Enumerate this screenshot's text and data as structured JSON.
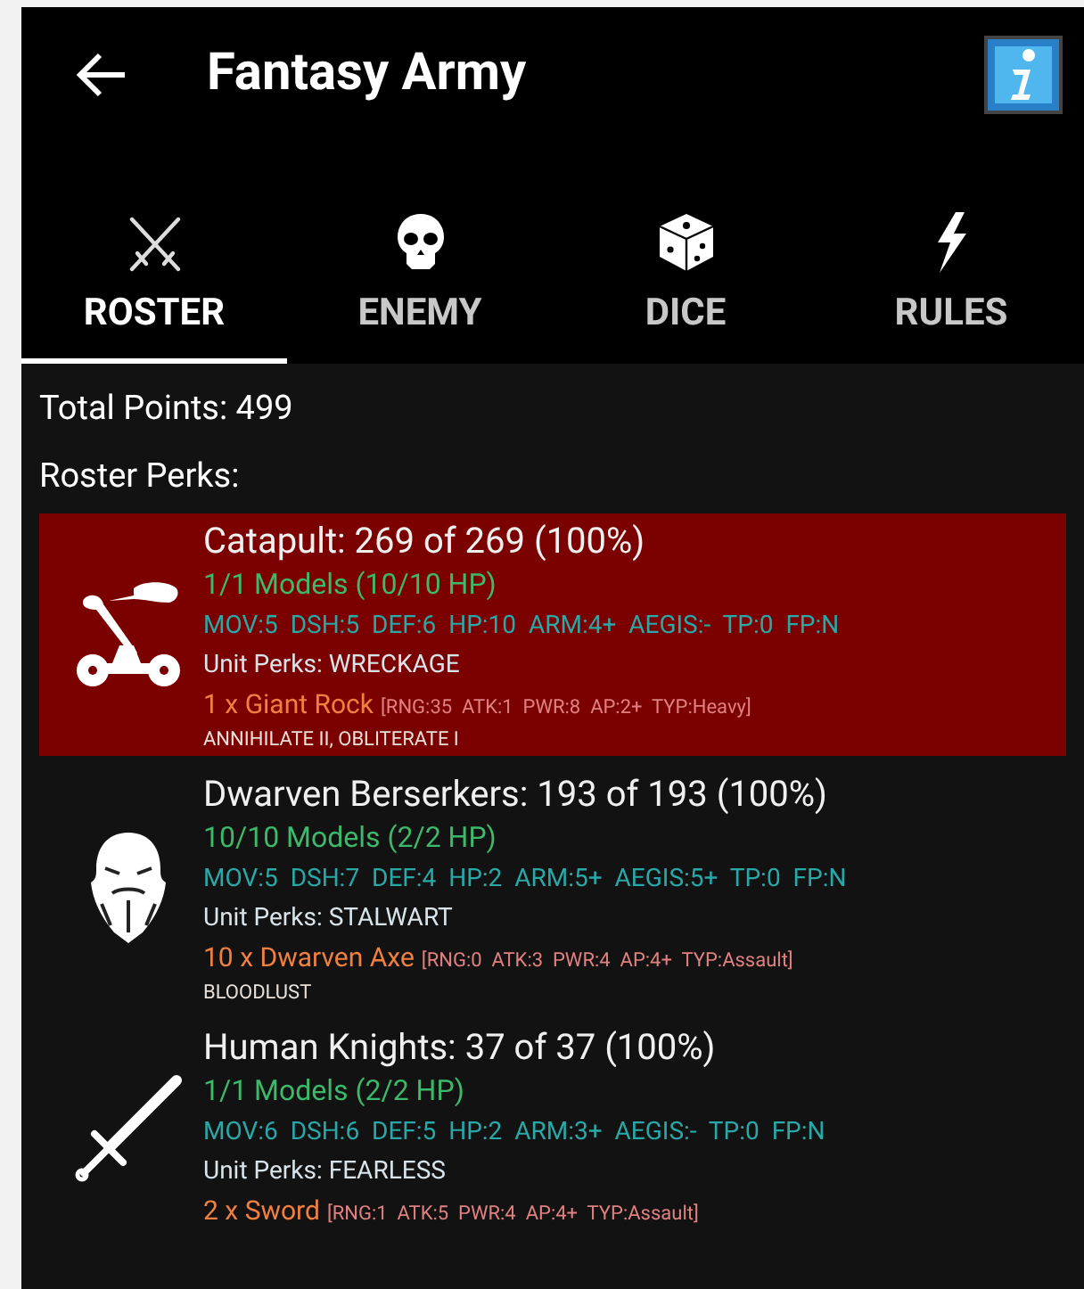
{
  "header": {
    "title": "Fantasy Army"
  },
  "tabs": [
    {
      "label": "ROSTER",
      "kind": "swords",
      "selected": true
    },
    {
      "label": "ENEMY",
      "kind": "skull",
      "selected": false
    },
    {
      "label": "DICE",
      "kind": "dice",
      "selected": false
    },
    {
      "label": "RULES",
      "kind": "bolt",
      "selected": false
    }
  ],
  "total_points": "Total Points: 499",
  "roster_perks": "Roster Perks:",
  "units": [
    {
      "kind": "catapult",
      "selected": true,
      "title": "Catapult: 269 of 269 (100%)",
      "models": "1/1 Models (10/10 HP)",
      "stats": "MOV:5  DSH:5  DEF:6  HP:10  ARM:4+  AEGIS:-  TP:0  FP:N",
      "perks": "Unit Perks: WRECKAGE",
      "weapon": "1 x Giant Rock",
      "weapon_stats": "[RNG:35  ATK:1  PWR:8  AP:2+  TYP:Heavy]",
      "weapon_rules": "ANNIHILATE II, OBLITERATE I"
    },
    {
      "kind": "dwarf",
      "selected": false,
      "title": "Dwarven Berserkers: 193 of 193 (100%)",
      "models": "10/10 Models (2/2 HP)",
      "stats": "MOV:5  DSH:7  DEF:4  HP:2  ARM:5+  AEGIS:5+  TP:0  FP:N",
      "perks": "Unit Perks: STALWART",
      "weapon": "10 x Dwarven Axe",
      "weapon_stats": "[RNG:0  ATK:3  PWR:4  AP:4+  TYP:Assault]",
      "weapon_rules": "BLOODLUST"
    },
    {
      "kind": "sword",
      "selected": false,
      "title": "Human Knights: 37 of 37 (100%)",
      "models": "1/1 Models (2/2 HP)",
      "stats": "MOV:6  DSH:6  DEF:5  HP:2  ARM:3+  AEGIS:-  TP:0  FP:N",
      "perks": "Unit Perks: FEARLESS",
      "weapon": "2 x Sword",
      "weapon_stats": "[RNG:1  ATK:5  PWR:4  AP:4+  TYP:Assault]"
    }
  ]
}
